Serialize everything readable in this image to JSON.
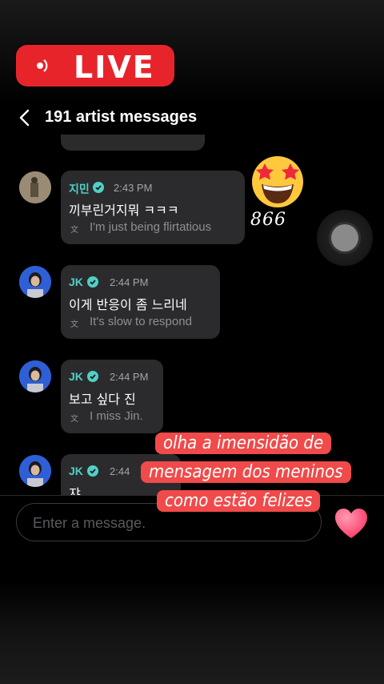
{
  "live_badge": {
    "label": "LIVE"
  },
  "header": {
    "title": "191 artist messages"
  },
  "messages": [
    {
      "sender": "지민",
      "time": "2:43 PM",
      "text": "끼부린거지뭐 ㅋㅋㅋ",
      "translation": "I'm just being flirtatious"
    },
    {
      "sender": "JK",
      "time": "2:44 PM",
      "text": "이게 반응이 좀 느리네",
      "translation": "It's slow to respond"
    },
    {
      "sender": "JK",
      "time": "2:44 PM",
      "text": "보고 싶다 진",
      "translation": "I miss Jin."
    },
    {
      "sender": "JK",
      "time": "2:44",
      "text": "쟈"
    }
  ],
  "sticker": {
    "icon": "star-struck-emoji-icon",
    "count": "866"
  },
  "caption": {
    "line1": "olha a imensidão de",
    "line2": "mensagem dos meninos",
    "line3": "como estão felizes"
  },
  "input": {
    "placeholder": "Enter a message."
  },
  "colors": {
    "live": "#e8242b",
    "accent_teal": "#4fd1c5",
    "bubble": "#2b2b2e",
    "caption_bg": "#f04a4a",
    "heart": "#ff4f7a"
  }
}
